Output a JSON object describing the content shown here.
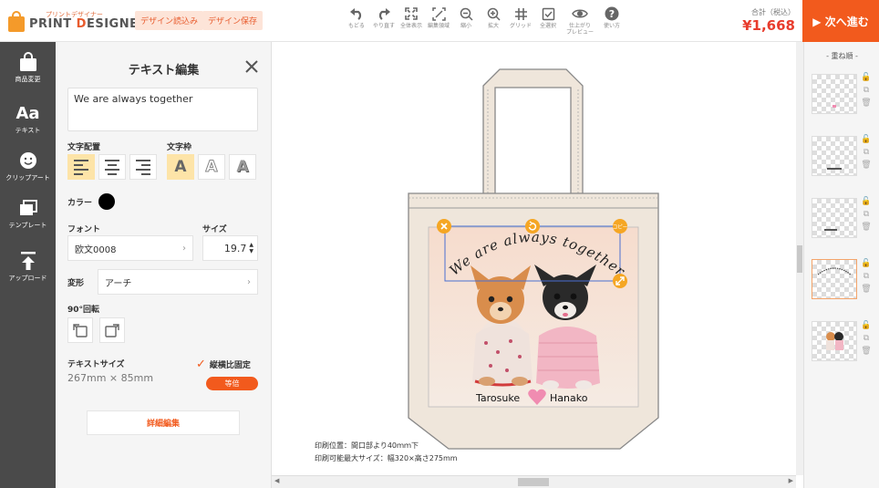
{
  "header": {
    "logo_sub": "プリントデザイナー",
    "logo_main_a": "PRINT ",
    "logo_main_d": "D",
    "logo_main_b": "ESIGNER",
    "load_design": "デザイン読込み",
    "save_design": "デザイン保存",
    "tools": [
      {
        "icon": "undo-icon",
        "label": "もどる"
      },
      {
        "icon": "redo-icon",
        "label": "やり直す"
      },
      {
        "icon": "fit-all-icon",
        "label": "全体表示"
      },
      {
        "icon": "edit-area-icon",
        "label": "編集領域"
      },
      {
        "icon": "zoom-out-icon",
        "label": "縮小"
      },
      {
        "icon": "zoom-in-icon",
        "label": "拡大"
      },
      {
        "icon": "grid-icon",
        "label": "グリッド"
      },
      {
        "icon": "select-all-icon",
        "label": "全選択"
      },
      {
        "icon": "preview-icon",
        "label": "仕上がり\nプレビュー"
      },
      {
        "icon": "help-icon",
        "label": "使い方"
      }
    ],
    "total_label": "合計（税込）",
    "total_value": "¥1,668",
    "next_button": "▶ 次へ進む"
  },
  "rail": [
    {
      "icon": "bag-icon",
      "label": "商品変更"
    },
    {
      "icon": "text-icon",
      "glyph": "Aa",
      "label": "テキスト"
    },
    {
      "icon": "clipart-icon",
      "label": "クリップアート"
    },
    {
      "icon": "template-icon",
      "label": "テンプレート"
    },
    {
      "icon": "upload-icon",
      "label": "アップロード"
    }
  ],
  "panel": {
    "title": "テキスト編集",
    "text_value": "We are always together",
    "align_label": "文字配置",
    "frame_label": "文字枠",
    "color_label": "カラー",
    "color_value": "#000000",
    "font_label": "フォント",
    "font_value": "欧文0008",
    "size_label": "サイズ",
    "size_value": "19.7",
    "transform_label": "変形",
    "transform_value": "アーチ",
    "rotate_label": "90°回転",
    "textsize_label": "テキストサイズ",
    "textsize_value": "267mm × 85mm",
    "keep_ratio_label": "縦横比固定",
    "same_scale_button": "等倍",
    "detail_button": "詳細編集"
  },
  "canvas": {
    "arch_text": "We are always together",
    "name_left": "Tarosuke",
    "name_right": "Hanako",
    "copy_handle": "コピー",
    "print_position": "印刷位置：間口部より40ｍｍ下",
    "print_max_size": "印刷可能最大サイズ：幅320×高さ275mm"
  },
  "layers": {
    "title": "- 重ね順 -"
  }
}
